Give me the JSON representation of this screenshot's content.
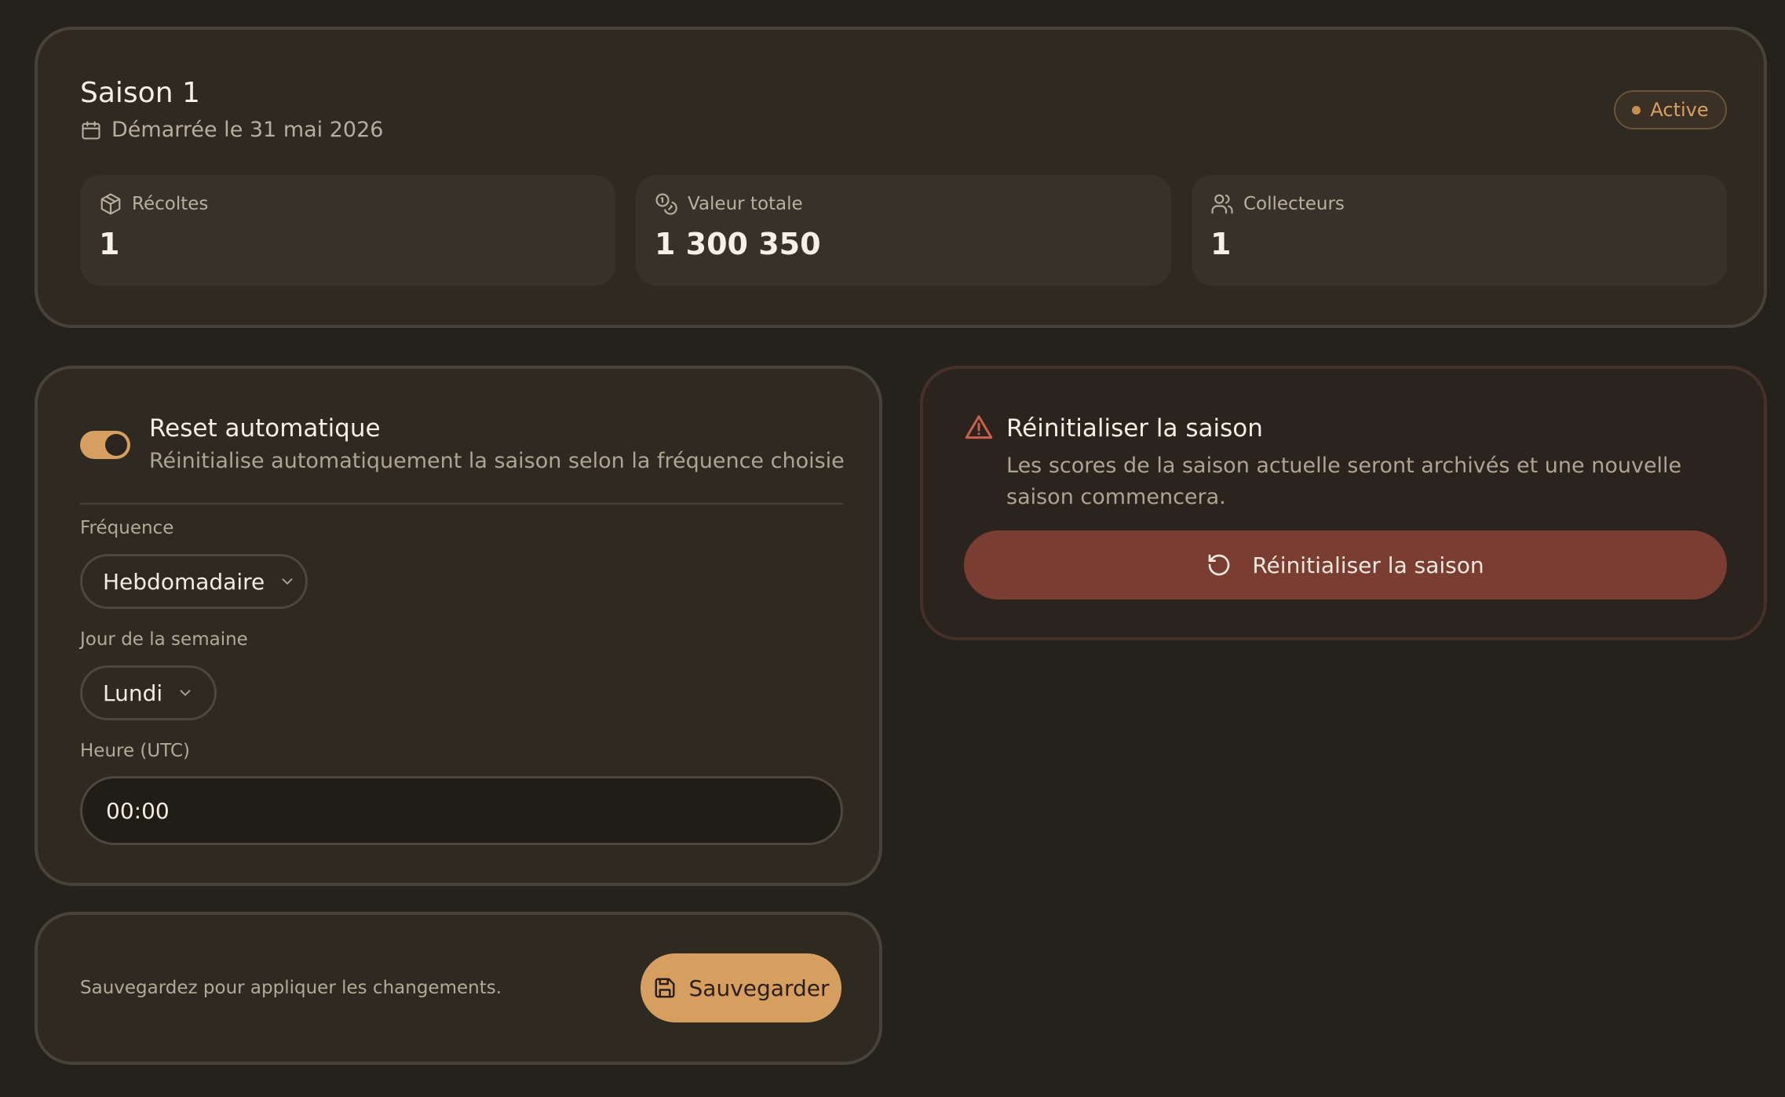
{
  "season": {
    "title": "Saison 1",
    "started": "Démarrée le 31 mai 2026",
    "status": "Active",
    "stats": [
      {
        "icon": "package-icon",
        "label": "Récoltes",
        "value": "1"
      },
      {
        "icon": "coins-icon",
        "label": "Valeur totale",
        "value": "1 300 350"
      },
      {
        "icon": "users-icon",
        "label": "Collecteurs",
        "value": "1"
      }
    ]
  },
  "auto_reset": {
    "title": "Reset automatique",
    "description": "Réinitialise automatiquement la saison selon la fréquence choisie",
    "enabled": true,
    "frequency_label": "Fréquence",
    "frequency_value": "Hebdomadaire",
    "day_label": "Jour de la semaine",
    "day_value": "Lundi",
    "time_label": "Heure (UTC)",
    "time_value": "00:00"
  },
  "save": {
    "hint": "Sauvegardez pour appliquer les changements.",
    "button_label": "Sauvegarder"
  },
  "danger": {
    "title": "Réinitialiser la saison",
    "description": "Les scores de la saison actuelle seront archivés et une nouvelle saison commencera.",
    "button_label": "Réinitialiser la saison"
  },
  "colors": {
    "background": "#25221b",
    "card": "#2e2a22",
    "accent": "#d69e5f",
    "danger": "#7a3d31"
  }
}
